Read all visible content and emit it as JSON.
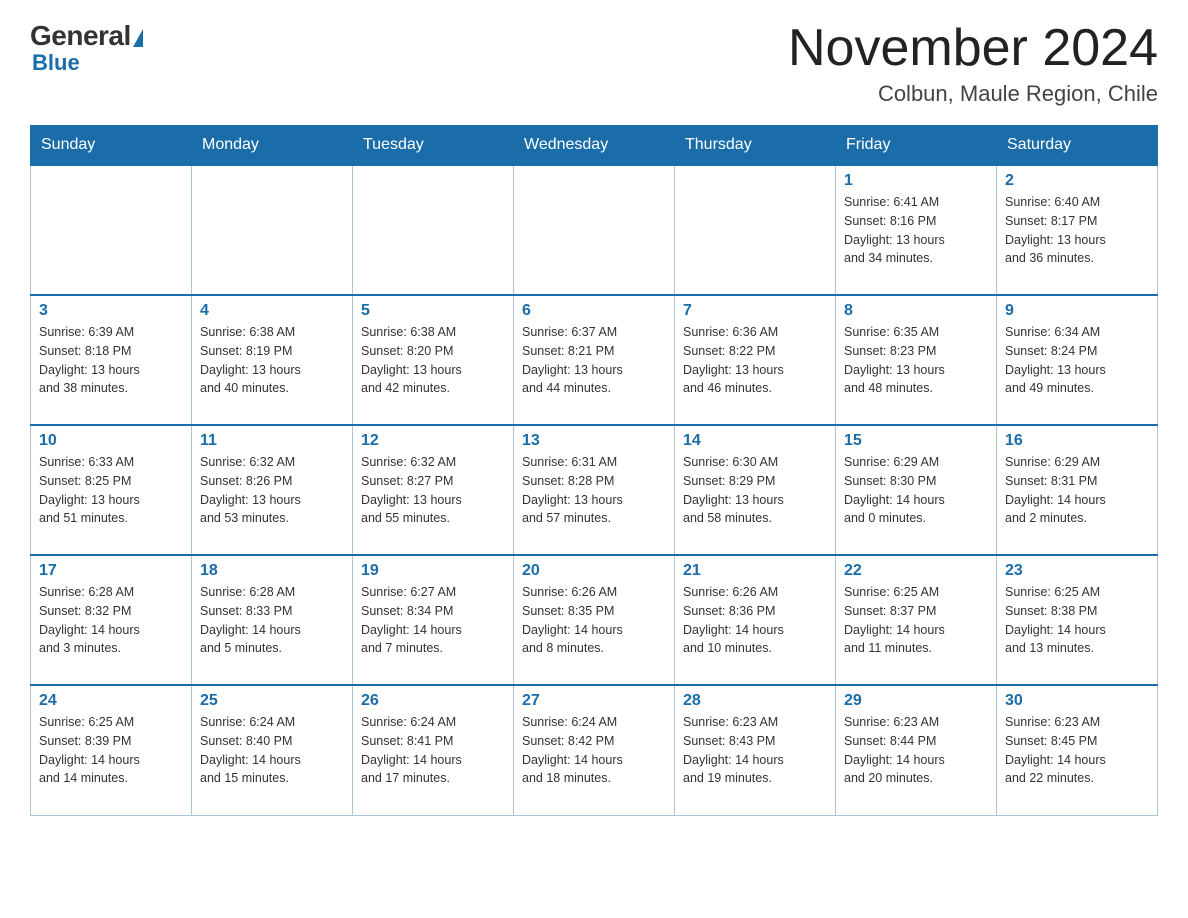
{
  "header": {
    "logo_general": "General",
    "logo_blue": "Blue",
    "month_title": "November 2024",
    "location": "Colbun, Maule Region, Chile"
  },
  "days_of_week": [
    "Sunday",
    "Monday",
    "Tuesday",
    "Wednesday",
    "Thursday",
    "Friday",
    "Saturday"
  ],
  "weeks": [
    [
      {
        "day": "",
        "info": "",
        "empty": true
      },
      {
        "day": "",
        "info": "",
        "empty": true
      },
      {
        "day": "",
        "info": "",
        "empty": true
      },
      {
        "day": "",
        "info": "",
        "empty": true
      },
      {
        "day": "",
        "info": "",
        "empty": true
      },
      {
        "day": "1",
        "info": "Sunrise: 6:41 AM\nSunset: 8:16 PM\nDaylight: 13 hours\nand 34 minutes."
      },
      {
        "day": "2",
        "info": "Sunrise: 6:40 AM\nSunset: 8:17 PM\nDaylight: 13 hours\nand 36 minutes."
      }
    ],
    [
      {
        "day": "3",
        "info": "Sunrise: 6:39 AM\nSunset: 8:18 PM\nDaylight: 13 hours\nand 38 minutes."
      },
      {
        "day": "4",
        "info": "Sunrise: 6:38 AM\nSunset: 8:19 PM\nDaylight: 13 hours\nand 40 minutes."
      },
      {
        "day": "5",
        "info": "Sunrise: 6:38 AM\nSunset: 8:20 PM\nDaylight: 13 hours\nand 42 minutes."
      },
      {
        "day": "6",
        "info": "Sunrise: 6:37 AM\nSunset: 8:21 PM\nDaylight: 13 hours\nand 44 minutes."
      },
      {
        "day": "7",
        "info": "Sunrise: 6:36 AM\nSunset: 8:22 PM\nDaylight: 13 hours\nand 46 minutes."
      },
      {
        "day": "8",
        "info": "Sunrise: 6:35 AM\nSunset: 8:23 PM\nDaylight: 13 hours\nand 48 minutes."
      },
      {
        "day": "9",
        "info": "Sunrise: 6:34 AM\nSunset: 8:24 PM\nDaylight: 13 hours\nand 49 minutes."
      }
    ],
    [
      {
        "day": "10",
        "info": "Sunrise: 6:33 AM\nSunset: 8:25 PM\nDaylight: 13 hours\nand 51 minutes."
      },
      {
        "day": "11",
        "info": "Sunrise: 6:32 AM\nSunset: 8:26 PM\nDaylight: 13 hours\nand 53 minutes."
      },
      {
        "day": "12",
        "info": "Sunrise: 6:32 AM\nSunset: 8:27 PM\nDaylight: 13 hours\nand 55 minutes."
      },
      {
        "day": "13",
        "info": "Sunrise: 6:31 AM\nSunset: 8:28 PM\nDaylight: 13 hours\nand 57 minutes."
      },
      {
        "day": "14",
        "info": "Sunrise: 6:30 AM\nSunset: 8:29 PM\nDaylight: 13 hours\nand 58 minutes."
      },
      {
        "day": "15",
        "info": "Sunrise: 6:29 AM\nSunset: 8:30 PM\nDaylight: 14 hours\nand 0 minutes."
      },
      {
        "day": "16",
        "info": "Sunrise: 6:29 AM\nSunset: 8:31 PM\nDaylight: 14 hours\nand 2 minutes."
      }
    ],
    [
      {
        "day": "17",
        "info": "Sunrise: 6:28 AM\nSunset: 8:32 PM\nDaylight: 14 hours\nand 3 minutes."
      },
      {
        "day": "18",
        "info": "Sunrise: 6:28 AM\nSunset: 8:33 PM\nDaylight: 14 hours\nand 5 minutes."
      },
      {
        "day": "19",
        "info": "Sunrise: 6:27 AM\nSunset: 8:34 PM\nDaylight: 14 hours\nand 7 minutes."
      },
      {
        "day": "20",
        "info": "Sunrise: 6:26 AM\nSunset: 8:35 PM\nDaylight: 14 hours\nand 8 minutes."
      },
      {
        "day": "21",
        "info": "Sunrise: 6:26 AM\nSunset: 8:36 PM\nDaylight: 14 hours\nand 10 minutes."
      },
      {
        "day": "22",
        "info": "Sunrise: 6:25 AM\nSunset: 8:37 PM\nDaylight: 14 hours\nand 11 minutes."
      },
      {
        "day": "23",
        "info": "Sunrise: 6:25 AM\nSunset: 8:38 PM\nDaylight: 14 hours\nand 13 minutes."
      }
    ],
    [
      {
        "day": "24",
        "info": "Sunrise: 6:25 AM\nSunset: 8:39 PM\nDaylight: 14 hours\nand 14 minutes."
      },
      {
        "day": "25",
        "info": "Sunrise: 6:24 AM\nSunset: 8:40 PM\nDaylight: 14 hours\nand 15 minutes."
      },
      {
        "day": "26",
        "info": "Sunrise: 6:24 AM\nSunset: 8:41 PM\nDaylight: 14 hours\nand 17 minutes."
      },
      {
        "day": "27",
        "info": "Sunrise: 6:24 AM\nSunset: 8:42 PM\nDaylight: 14 hours\nand 18 minutes."
      },
      {
        "day": "28",
        "info": "Sunrise: 6:23 AM\nSunset: 8:43 PM\nDaylight: 14 hours\nand 19 minutes."
      },
      {
        "day": "29",
        "info": "Sunrise: 6:23 AM\nSunset: 8:44 PM\nDaylight: 14 hours\nand 20 minutes."
      },
      {
        "day": "30",
        "info": "Sunrise: 6:23 AM\nSunset: 8:45 PM\nDaylight: 14 hours\nand 22 minutes."
      }
    ]
  ]
}
